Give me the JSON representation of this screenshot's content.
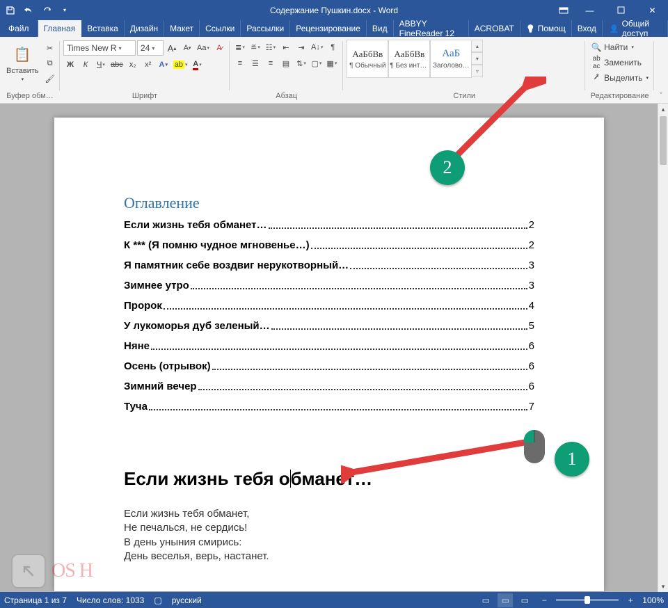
{
  "titlebar": {
    "title": "Содержание Пушкин.docx - Word"
  },
  "tabs": {
    "file": "Файл",
    "home": "Главная",
    "insert": "Вставка",
    "design": "Дизайн",
    "layout": "Макет",
    "refs": "Ссылки",
    "mail": "Рассылки",
    "review": "Рецензирование",
    "view": "Вид",
    "abbyy": "ABBYY FineReader 12",
    "acrobat": "ACROBAT",
    "help": "Помощ",
    "login": "Вход",
    "share": "Общий доступ"
  },
  "ribbon": {
    "clipboard": {
      "label": "Буфер обм…",
      "paste": "Вставить"
    },
    "font": {
      "label": "Шрифт",
      "family": "Times New R",
      "size": "24",
      "bold": "Ж",
      "italic": "К",
      "underline": "Ч",
      "strike": "abc",
      "sub": "x₂",
      "sup": "x²"
    },
    "para": {
      "label": "Абзац"
    },
    "styles": {
      "label": "Стили",
      "items": [
        {
          "preview": "АаБбВв",
          "name": "¶ Обычный"
        },
        {
          "preview": "АаБбВв",
          "name": "¶ Без инте…"
        },
        {
          "preview": "АаБ",
          "name": "Заголово…",
          "heading": true
        }
      ]
    },
    "editing": {
      "label": "Редактирование",
      "find": "Найти",
      "replace": "Заменить",
      "select": "Выделить"
    }
  },
  "doc": {
    "toc_title": "Оглавление",
    "toc": [
      {
        "t": "Если жизнь тебя обманет…",
        "p": "2"
      },
      {
        "t": "К *** (Я помню чудное мгновенье…)",
        "p": "2"
      },
      {
        "t": "Я памятник себе воздвиг нерукотворный…",
        "p": "3"
      },
      {
        "t": "Зимнее утро",
        "p": "3"
      },
      {
        "t": "Пророк",
        "p": "4"
      },
      {
        "t": "У лукоморья дуб зеленый…",
        "p": "5"
      },
      {
        "t": "Няне",
        "p": "6"
      },
      {
        "t": "Осень (отрывок)",
        "p": "6"
      },
      {
        "t": "Зимний вечер",
        "p": "6"
      },
      {
        "t": "Туча",
        "p": "7"
      }
    ],
    "h1_a": "Если жизнь тебя о",
    "h1_b": "бманет…",
    "body1": "Если жизнь тебя обманет,",
    "body2": "Не печалься, не сердись!",
    "body3": "В день уныния смирись:",
    "body4": "День веселья, верь, настанет."
  },
  "status": {
    "page": "Страница 1 из 7",
    "words": "Число слов: 1033",
    "lang": "русский",
    "zoom": "100%"
  },
  "annot": {
    "one": "1",
    "two": "2"
  },
  "watermark": "OS H"
}
